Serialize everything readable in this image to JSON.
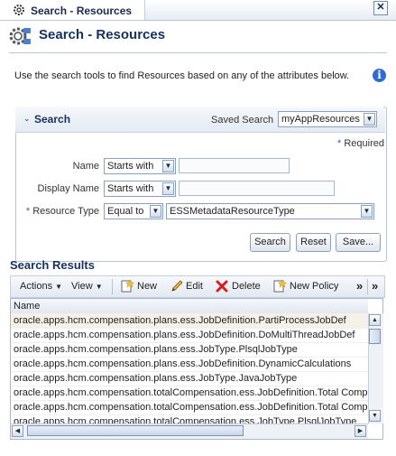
{
  "tab": {
    "title": "Search - Resources",
    "close_label": "✕"
  },
  "page": {
    "title": "Search - Resources",
    "description": "Use the search tools to find Resources based on any of the attributes below."
  },
  "search": {
    "heading": "Search",
    "saved_search_label": "Saved Search",
    "saved_search_value": "myAppResources",
    "required_label": "Required",
    "fields": {
      "name": {
        "label": "Name",
        "operator": "Starts with",
        "value": ""
      },
      "display_name": {
        "label": "Display Name",
        "operator": "Starts with",
        "value": ""
      },
      "resource_type": {
        "label": "Resource Type",
        "operator": "Equal to",
        "value": "ESSMetadataResourceType"
      }
    },
    "buttons": {
      "search": "Search",
      "reset": "Reset",
      "save": "Save..."
    }
  },
  "results": {
    "heading": "Search Results",
    "toolbar": {
      "actions": "Actions",
      "view": "View",
      "new": "New",
      "edit": "Edit",
      "delete": "Delete",
      "new_policy": "New Policy",
      "overflow": "»",
      "detach": "»"
    },
    "column_name": "Name",
    "rows": [
      "oracle.apps.hcm.compensation.plans.ess.JobDefinition.PartiProcessJobDef",
      "oracle.apps.hcm.compensation.plans.ess.JobDefinition.DoMultiThreadJobDef",
      "oracle.apps.hcm.compensation.plans.ess.JobType.PlsqlJobType",
      "oracle.apps.hcm.compensation.plans.ess.JobDefinition.DynamicCalculations",
      "oracle.apps.hcm.compensation.plans.ess.JobType.JavaJobType",
      "oracle.apps.hcm.compensation.totalCompensation.ess.JobDefinition.Total Compe",
      "oracle.apps.hcm.compensation.totalCompensation.ess.JobDefinition.Total Compe",
      "oracle.apps.hcm.compensation.totalCompensation.ess.JobType.PlsqlJobType"
    ]
  },
  "colors": {
    "title": "#16305f",
    "accent": "#2f6bd0",
    "delete": "#d22020",
    "selected_row": "#f6f1e8"
  }
}
